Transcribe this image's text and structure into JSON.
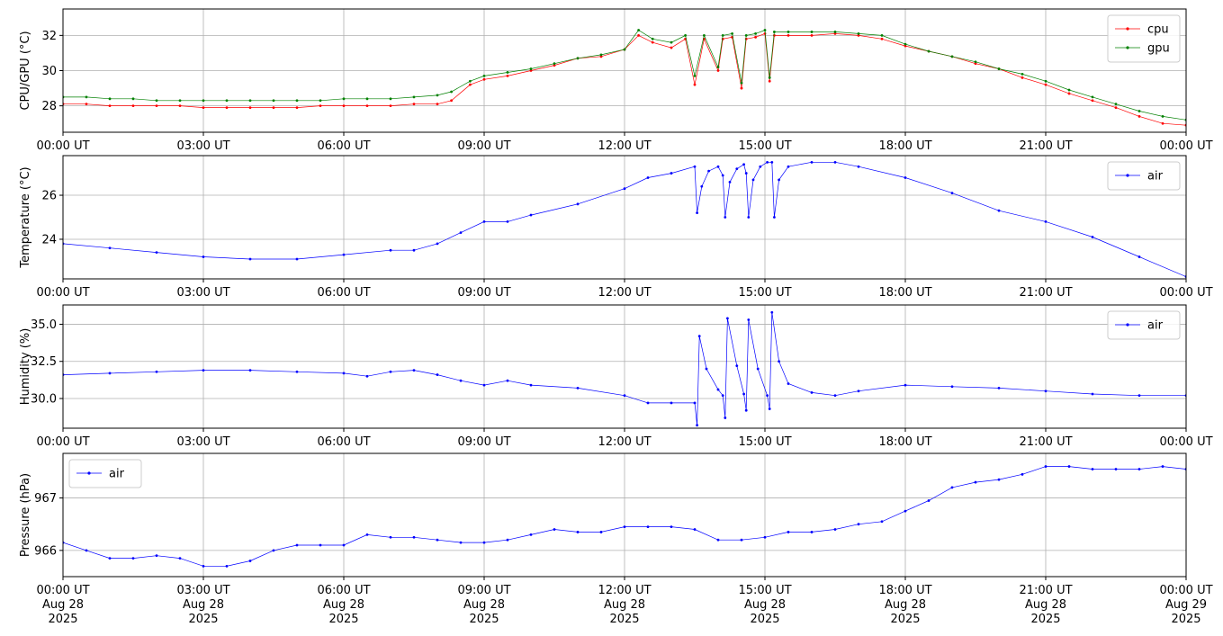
{
  "chart_data": [
    {
      "type": "line",
      "ylabel": "CPU/GPU (°C)",
      "ylim": [
        26.5,
        33.5
      ],
      "yticks": [
        28,
        30,
        32
      ],
      "ytick_labels": [
        "28",
        "30",
        "32"
      ],
      "xlim": [
        0,
        24
      ],
      "xticks": [
        0,
        3,
        6,
        9,
        12,
        15,
        18,
        21,
        24
      ],
      "xtick_labels": [
        "00:00 UT",
        "03:00 UT",
        "06:00 UT",
        "09:00 UT",
        "12:00 UT",
        "15:00 UT",
        "18:00 UT",
        "21:00 UT",
        "00:00 UT"
      ],
      "grid": true,
      "legend_position": "upper right",
      "series": [
        {
          "name": "cpu",
          "color": "#ff0000",
          "x": [
            0,
            0.5,
            1,
            1.5,
            2,
            2.5,
            3,
            3.5,
            4,
            4.5,
            5,
            5.5,
            6,
            6.5,
            7,
            7.5,
            8,
            8.3,
            8.7,
            9,
            9.5,
            10,
            10.5,
            11,
            11.5,
            12,
            12.3,
            12.6,
            13,
            13.3,
            13.5,
            13.7,
            14,
            14.1,
            14.3,
            14.5,
            14.6,
            14.8,
            15,
            15.1,
            15.2,
            15.5,
            16,
            16.5,
            17,
            17.5,
            18,
            18.5,
            19,
            19.5,
            20,
            20.5,
            21,
            21.5,
            22,
            22.5,
            23,
            23.5,
            24
          ],
          "y": [
            28.1,
            28.1,
            28.0,
            28.0,
            28.0,
            28.0,
            27.9,
            27.9,
            27.9,
            27.9,
            27.9,
            28.0,
            28.0,
            28.0,
            28.0,
            28.1,
            28.1,
            28.3,
            29.2,
            29.5,
            29.7,
            30.0,
            30.3,
            30.7,
            30.8,
            31.2,
            32.0,
            31.6,
            31.3,
            31.8,
            29.2,
            31.8,
            30.0,
            31.8,
            31.9,
            29.0,
            31.8,
            31.9,
            32.1,
            29.4,
            32.0,
            32.0,
            32.0,
            32.1,
            32.0,
            31.8,
            31.4,
            31.1,
            30.8,
            30.4,
            30.1,
            29.6,
            29.2,
            28.7,
            28.3,
            27.9,
            27.4,
            27.0,
            26.9
          ]
        },
        {
          "name": "gpu",
          "color": "#008000",
          "x": [
            0,
            0.5,
            1,
            1.5,
            2,
            2.5,
            3,
            3.5,
            4,
            4.5,
            5,
            5.5,
            6,
            6.5,
            7,
            7.5,
            8,
            8.3,
            8.7,
            9,
            9.5,
            10,
            10.5,
            11,
            11.5,
            12,
            12.3,
            12.6,
            13,
            13.3,
            13.5,
            13.7,
            14,
            14.1,
            14.3,
            14.5,
            14.6,
            14.8,
            15,
            15.1,
            15.2,
            15.5,
            16,
            16.5,
            17,
            17.5,
            18,
            18.5,
            19,
            19.5,
            20,
            20.5,
            21,
            21.5,
            22,
            22.5,
            23,
            23.5,
            24
          ],
          "y": [
            28.5,
            28.5,
            28.4,
            28.4,
            28.3,
            28.3,
            28.3,
            28.3,
            28.3,
            28.3,
            28.3,
            28.3,
            28.4,
            28.4,
            28.4,
            28.5,
            28.6,
            28.8,
            29.4,
            29.7,
            29.9,
            30.1,
            30.4,
            30.7,
            30.9,
            31.2,
            32.3,
            31.8,
            31.6,
            32.0,
            29.7,
            32.0,
            30.2,
            32.0,
            32.1,
            29.3,
            32.0,
            32.1,
            32.3,
            29.6,
            32.2,
            32.2,
            32.2,
            32.2,
            32.1,
            32.0,
            31.5,
            31.1,
            30.8,
            30.5,
            30.1,
            29.8,
            29.4,
            28.9,
            28.5,
            28.1,
            27.7,
            27.4,
            27.2
          ]
        }
      ]
    },
    {
      "type": "line",
      "ylabel": "Temperature (°C)",
      "ylim": [
        22.2,
        27.8
      ],
      "yticks": [
        24,
        26
      ],
      "ytick_labels": [
        "24",
        "26"
      ],
      "xlim": [
        0,
        24
      ],
      "xticks": [
        0,
        3,
        6,
        9,
        12,
        15,
        18,
        21,
        24
      ],
      "xtick_labels": [
        "00:00 UT",
        "03:00 UT",
        "06:00 UT",
        "09:00 UT",
        "12:00 UT",
        "15:00 UT",
        "18:00 UT",
        "21:00 UT",
        "00:00 UT"
      ],
      "grid": true,
      "legend_position": "upper right",
      "series": [
        {
          "name": "air",
          "color": "#0000ff",
          "x": [
            0,
            1,
            2,
            3,
            4,
            5,
            6,
            7,
            7.5,
            8,
            8.5,
            9,
            9.5,
            10,
            11,
            12,
            12.5,
            13,
            13.5,
            13.55,
            13.65,
            13.8,
            14,
            14.1,
            14.15,
            14.25,
            14.4,
            14.55,
            14.6,
            14.65,
            14.75,
            14.9,
            15.05,
            15.15,
            15.2,
            15.3,
            15.5,
            16,
            16.5,
            17,
            18,
            19,
            20,
            21,
            22,
            23,
            24
          ],
          "y": [
            23.8,
            23.6,
            23.4,
            23.2,
            23.1,
            23.1,
            23.3,
            23.5,
            23.5,
            23.8,
            24.3,
            24.8,
            24.8,
            25.1,
            25.6,
            26.3,
            26.8,
            27.0,
            27.3,
            25.2,
            26.4,
            27.1,
            27.3,
            26.9,
            25.0,
            26.6,
            27.2,
            27.4,
            27.0,
            25.0,
            26.7,
            27.3,
            27.5,
            27.5,
            25.0,
            26.7,
            27.3,
            27.5,
            27.5,
            27.3,
            26.8,
            26.1,
            25.3,
            24.8,
            24.1,
            23.2,
            22.3
          ]
        }
      ]
    },
    {
      "type": "line",
      "ylabel": "Humidity (%)",
      "ylim": [
        28,
        36.3
      ],
      "yticks": [
        30.0,
        32.5,
        35.0
      ],
      "ytick_labels": [
        "30.0",
        "32.5",
        "35.0"
      ],
      "xlim": [
        0,
        24
      ],
      "xticks": [
        0,
        3,
        6,
        9,
        12,
        15,
        18,
        21,
        24
      ],
      "xtick_labels": [
        "00:00 UT",
        "03:00 UT",
        "06:00 UT",
        "09:00 UT",
        "12:00 UT",
        "15:00 UT",
        "18:00 UT",
        "21:00 UT",
        "00:00 UT"
      ],
      "grid": true,
      "legend_position": "upper right",
      "series": [
        {
          "name": "air",
          "color": "#0000ff",
          "x": [
            0,
            1,
            2,
            3,
            4,
            5,
            6,
            6.5,
            7,
            7.5,
            8,
            8.5,
            9,
            9.5,
            10,
            11,
            12,
            12.5,
            13,
            13.5,
            13.55,
            13.6,
            13.75,
            14,
            14.1,
            14.15,
            14.2,
            14.4,
            14.55,
            14.6,
            14.65,
            14.85,
            15.05,
            15.1,
            15.15,
            15.3,
            15.5,
            16,
            16.5,
            17,
            18,
            19,
            20,
            21,
            22,
            23,
            24
          ],
          "y": [
            31.6,
            31.7,
            31.8,
            31.9,
            31.9,
            31.8,
            31.7,
            31.5,
            31.8,
            31.9,
            31.6,
            31.2,
            30.9,
            31.2,
            30.9,
            30.7,
            30.2,
            29.7,
            29.7,
            29.7,
            28.2,
            34.2,
            32.0,
            30.6,
            30.2,
            28.7,
            35.4,
            32.2,
            30.3,
            29.2,
            35.3,
            32.0,
            30.2,
            29.3,
            35.8,
            32.5,
            31.0,
            30.4,
            30.2,
            30.5,
            30.9,
            30.8,
            30.7,
            30.5,
            30.3,
            30.2,
            30.2
          ]
        }
      ]
    },
    {
      "type": "line",
      "ylabel": "Pressure (hPa)",
      "ylim": [
        965.5,
        967.85
      ],
      "yticks": [
        966,
        967
      ],
      "ytick_labels": [
        "966",
        "967"
      ],
      "xlim": [
        0,
        24
      ],
      "xticks": [
        0,
        3,
        6,
        9,
        12,
        15,
        18,
        21,
        24
      ],
      "xtick_labels": [
        "00:00 UT\nAug 28\n2025",
        "03:00 UT\nAug 28\n2025",
        "06:00 UT\nAug 28\n2025",
        "09:00 UT\nAug 28\n2025",
        "12:00 UT\nAug 28\n2025",
        "15:00 UT\nAug 28\n2025",
        "18:00 UT\nAug 28\n2025",
        "21:00 UT\nAug 28\n2025",
        "00:00 UT\nAug 29\n2025"
      ],
      "grid": true,
      "legend_position": "upper left",
      "series": [
        {
          "name": "air",
          "color": "#0000ff",
          "x": [
            0,
            0.5,
            1,
            1.5,
            2,
            2.5,
            3,
            3.5,
            4,
            4.5,
            5,
            5.5,
            6,
            6.5,
            7,
            7.5,
            8,
            8.5,
            9,
            9.5,
            10,
            10.5,
            11,
            11.5,
            12,
            12.5,
            13,
            13.5,
            14,
            14.5,
            15,
            15.5,
            16,
            16.5,
            17,
            17.5,
            18,
            18.5,
            19,
            19.5,
            20,
            20.5,
            21,
            21.5,
            22,
            22.5,
            23,
            23.5,
            24
          ],
          "y": [
            966.15,
            966.0,
            965.85,
            965.85,
            965.9,
            965.85,
            965.7,
            965.7,
            965.8,
            966.0,
            966.1,
            966.1,
            966.1,
            966.3,
            966.25,
            966.25,
            966.2,
            966.15,
            966.15,
            966.2,
            966.3,
            966.4,
            966.35,
            966.35,
            966.45,
            966.45,
            966.45,
            966.4,
            966.2,
            966.2,
            966.25,
            966.35,
            966.35,
            966.4,
            966.5,
            966.55,
            966.75,
            966.95,
            967.2,
            967.3,
            967.35,
            967.45,
            967.6,
            967.6,
            967.55,
            967.55,
            967.55,
            967.6,
            967.55
          ]
        }
      ]
    }
  ]
}
